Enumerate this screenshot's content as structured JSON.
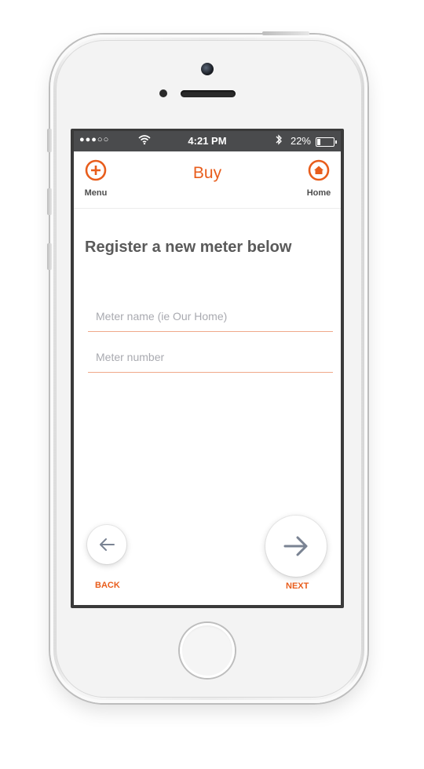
{
  "status_bar": {
    "carrier_signal": "●●●○○",
    "time": "4:21 PM",
    "battery_percent": "22%",
    "battery_level": 0.22,
    "icons": [
      "wifi-icon",
      "bluetooth-icon",
      "battery-icon"
    ]
  },
  "nav": {
    "title": "Buy",
    "menu_label": "Menu",
    "menu_icon": "plus-circle-icon",
    "home_label": "Home",
    "home_icon": "home-circle-icon"
  },
  "main": {
    "heading": "Register a new meter below",
    "fields": {
      "meter_name": {
        "placeholder": "Meter name (ie Our Home)",
        "value": ""
      },
      "meter_number": {
        "placeholder": "Meter number",
        "value": ""
      }
    }
  },
  "actions": {
    "back_label": "BACK",
    "back_icon": "arrow-left-icon",
    "next_label": "NEXT",
    "next_icon": "arrow-right-icon"
  },
  "colors": {
    "accent": "#e85d1c",
    "status_bar": "#4a4b4d",
    "heading_text": "#5a5a5a",
    "field_underline": "#f0a98a",
    "placeholder": "#a9aab0",
    "arrow": "#7a8393"
  }
}
